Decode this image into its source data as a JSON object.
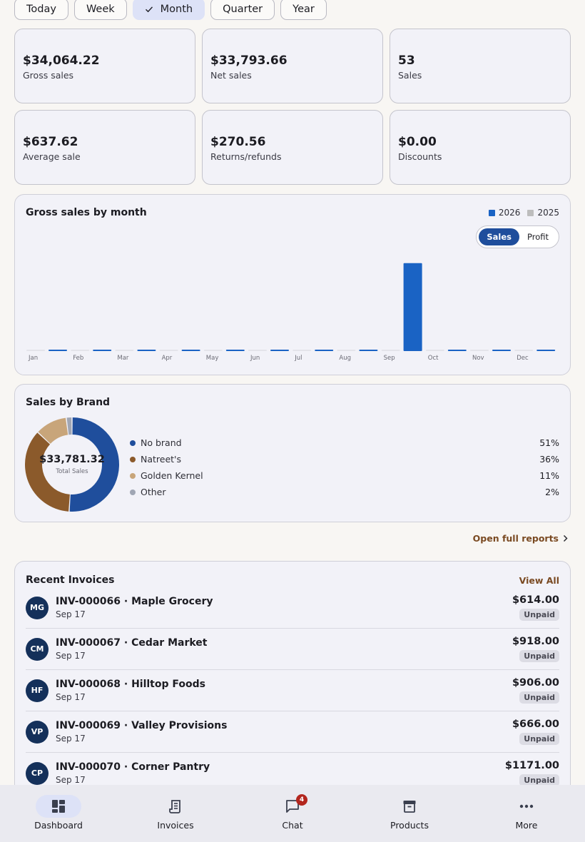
{
  "period_filters": [
    {
      "label": "Today",
      "active": false
    },
    {
      "label": "Week",
      "active": false
    },
    {
      "label": "Month",
      "active": true
    },
    {
      "label": "Quarter",
      "active": false
    },
    {
      "label": "Year",
      "active": false
    }
  ],
  "stats": [
    {
      "value": "$34,064.22",
      "label": "Gross sales"
    },
    {
      "value": "$33,793.66",
      "label": "Net sales"
    },
    {
      "value": "53",
      "label": "Sales"
    },
    {
      "value": "$637.62",
      "label": "Average sale"
    },
    {
      "value": "$270.56",
      "label": "Returns/refunds"
    },
    {
      "value": "$0.00",
      "label": "Discounts"
    }
  ],
  "gross_chart": {
    "title": "Gross sales by month",
    "legend": [
      {
        "label": "2026",
        "color": "#1a63c4"
      },
      {
        "label": "2025",
        "color": "#bdbdbd"
      }
    ],
    "toggle": {
      "sales_label": "Sales",
      "profit_label": "Profit",
      "active": "Sales"
    }
  },
  "chart_data": {
    "type": "bar",
    "title": "Gross sales by month",
    "categories": [
      "Jan",
      "Feb",
      "Mar",
      "Apr",
      "May",
      "Jun",
      "Jul",
      "Aug",
      "Sep",
      "Oct",
      "Nov",
      "Dec"
    ],
    "series": [
      {
        "name": "2025",
        "color": "#bdbdbd",
        "values": [
          0,
          0,
          0,
          0,
          0,
          0,
          0,
          0,
          0,
          0,
          0,
          0
        ]
      },
      {
        "name": "2026",
        "color": "#1a63c4",
        "values": [
          0,
          0,
          0,
          0,
          0,
          0,
          0,
          270,
          33794,
          0,
          0,
          0
        ]
      }
    ],
    "ylim": [
      0,
      34000
    ],
    "grid": false,
    "legend": "top-right",
    "xlabel": "",
    "ylabel": ""
  },
  "brand": {
    "title": "Sales by Brand",
    "total": "$33,781.32",
    "total_label": "Total Sales",
    "items": [
      {
        "name": "No brand",
        "pct_label": "51%",
        "pct": 51,
        "color": "#1f4e9c"
      },
      {
        "name": "Natreet's",
        "pct_label": "36%",
        "pct": 36,
        "color": "#8b5a2b"
      },
      {
        "name": "Golden Kernel",
        "pct_label": "11%",
        "pct": 11,
        "color": "#c8a57a"
      },
      {
        "name": "Other",
        "pct_label": "2%",
        "pct": 2,
        "color": "#a0a6b4"
      }
    ]
  },
  "reports_link": "Open full reports",
  "invoices": {
    "title": "Recent Invoices",
    "view_all": "View All",
    "rows": [
      {
        "initials": "MG",
        "title": "INV-000066 · Maple Grocery",
        "date": "Sep 17",
        "amount": "$614.00",
        "status": "Unpaid"
      },
      {
        "initials": "CM",
        "title": "INV-000067 · Cedar Market",
        "date": "Sep 17",
        "amount": "$918.00",
        "status": "Unpaid"
      },
      {
        "initials": "HF",
        "title": "INV-000068 · Hilltop Foods",
        "date": "Sep 17",
        "amount": "$906.00",
        "status": "Unpaid"
      },
      {
        "initials": "VP",
        "title": "INV-000069 · Valley Provisions",
        "date": "Sep 17",
        "amount": "$666.00",
        "status": "Unpaid"
      },
      {
        "initials": "CP",
        "title": "INV-000070 · Corner Pantry",
        "date": "Sep 17",
        "amount": "$1171.00",
        "status": "Unpaid"
      }
    ]
  },
  "nav": [
    {
      "label": "Dashboard",
      "icon": "dashboard-icon",
      "active": true
    },
    {
      "label": "Invoices",
      "icon": "receipt-icon",
      "active": false
    },
    {
      "label": "Chat",
      "icon": "chat-icon",
      "active": false,
      "badge": "4"
    },
    {
      "label": "Products",
      "icon": "archive-box-icon",
      "active": false
    },
    {
      "label": "More",
      "icon": "more-horizontal-icon",
      "active": false
    }
  ]
}
